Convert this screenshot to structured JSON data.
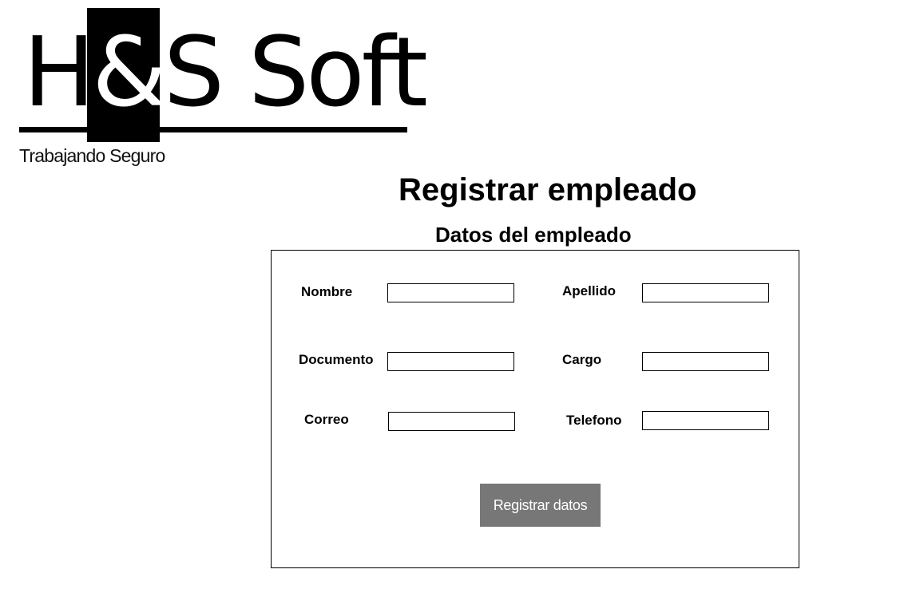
{
  "logo": {
    "text_before": "H",
    "ampersand": "&",
    "text_after": "S Soft",
    "tagline": "Trabajando Seguro"
  },
  "page": {
    "title": "Registrar empleado",
    "section_title": "Datos del empleado"
  },
  "form": {
    "nombre_label": "Nombre",
    "apellido_label": "Apellido",
    "documento_label": "Documento",
    "cargo_label": "Cargo",
    "correo_label": "Correo",
    "telefono_label": "Telefono",
    "nombre_value": "",
    "apellido_value": "",
    "documento_value": "",
    "cargo_value": "",
    "correo_value": "",
    "telefono_value": "",
    "submit_label": "Registrar datos"
  },
  "colors": {
    "button_bg": "#777777",
    "button_text": "#ffffff",
    "border": "#000000"
  }
}
